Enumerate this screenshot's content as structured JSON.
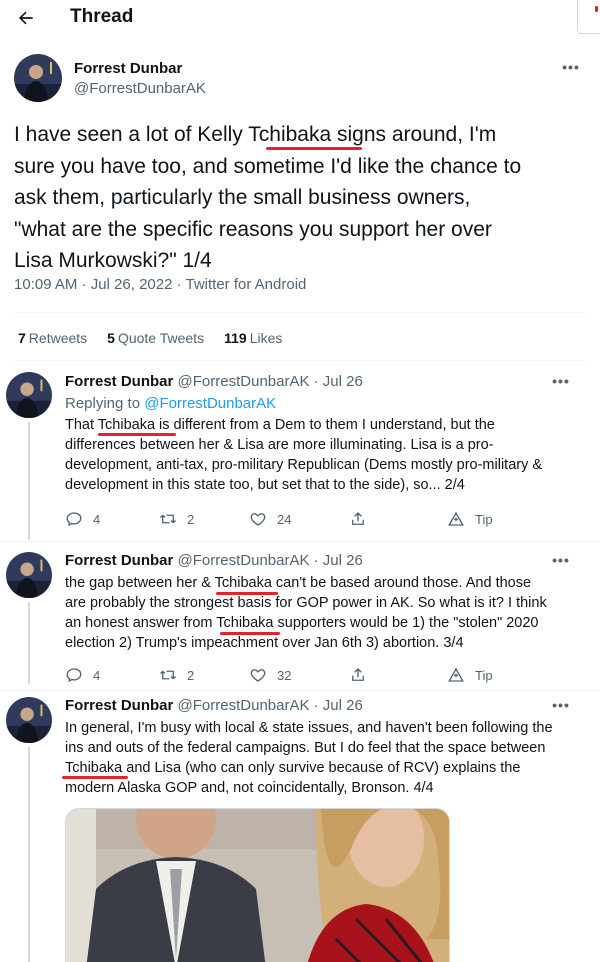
{
  "header": {
    "title": "Thread"
  },
  "main_tweet": {
    "name": "Forrest Dunbar",
    "handle": "@ForrestDunbarAK",
    "text_lines": [
      "I have seen a lot of Kelly Tchibaka signs around, I'm",
      "sure you have too, and sometime I'd like the chance to",
      "ask them, particularly the small business owners,",
      "\"what are the specific reasons you support her over",
      "Lisa Murkowski?\" 1/4"
    ],
    "meta": "10:09 AM · Jul 26, 2022 · Twitter for Android",
    "stats": {
      "retweets_count": "7",
      "retweets_label": "Retweets",
      "quotes_count": "5",
      "quotes_label": "Quote Tweets",
      "likes_count": "119",
      "likes_label": "Likes"
    }
  },
  "replies": [
    {
      "name": "Forrest Dunbar",
      "handle_date": "@ForrestDunbarAK · Jul 26",
      "replying_prefix": "Replying to",
      "replying_handle": "@ForrestDunbarAK",
      "text_lines": [
        "That Tchibaka is different from a Dem to them I understand, but the",
        "differences between her & Lisa are more illuminating. Lisa is a pro-",
        "development, anti-tax, pro-military Republican (Dems mostly pro-military &",
        "development in this state too, but set that to the side), so... 2/4"
      ],
      "replies_count": "4",
      "retweets_count": "2",
      "likes_count": "24",
      "tip_label": "Tip"
    },
    {
      "name": "Forrest Dunbar",
      "handle_date": "@ForrestDunbarAK · Jul 26",
      "text_lines": [
        "the gap between her & Tchibaka can't be based around those. And those",
        "are probably the strongest basis for GOP power in AK. So what is it? I think",
        "an honest answer from Tchibaka supporters would be 1) the \"stolen\" 2020",
        "election 2) Trump's impeachment over Jan 6th 3) abortion. 3/4"
      ],
      "replies_count": "4",
      "retweets_count": "2",
      "likes_count": "32",
      "tip_label": "Tip"
    },
    {
      "name": "Forrest Dunbar",
      "handle_date": "@ForrestDunbarAK · Jul 26",
      "text_lines": [
        "In general, I'm busy with local & state issues, and haven't been following the",
        "ins and outs of the federal campaigns. But I do feel that the space between",
        "Tchibaka and Lisa (who can only survive because of RCV) explains the",
        "modern Alaska GOP and, not coincidentally, Bronson. 4/4"
      ]
    }
  ],
  "colors": {
    "accent": "#1d9bf0",
    "underline": "#e0242c",
    "muted": "#536471"
  },
  "icons": [
    "back-arrow-icon",
    "more-icon",
    "reply-icon",
    "retweet-icon",
    "like-icon",
    "share-icon",
    "tip-icon"
  ]
}
